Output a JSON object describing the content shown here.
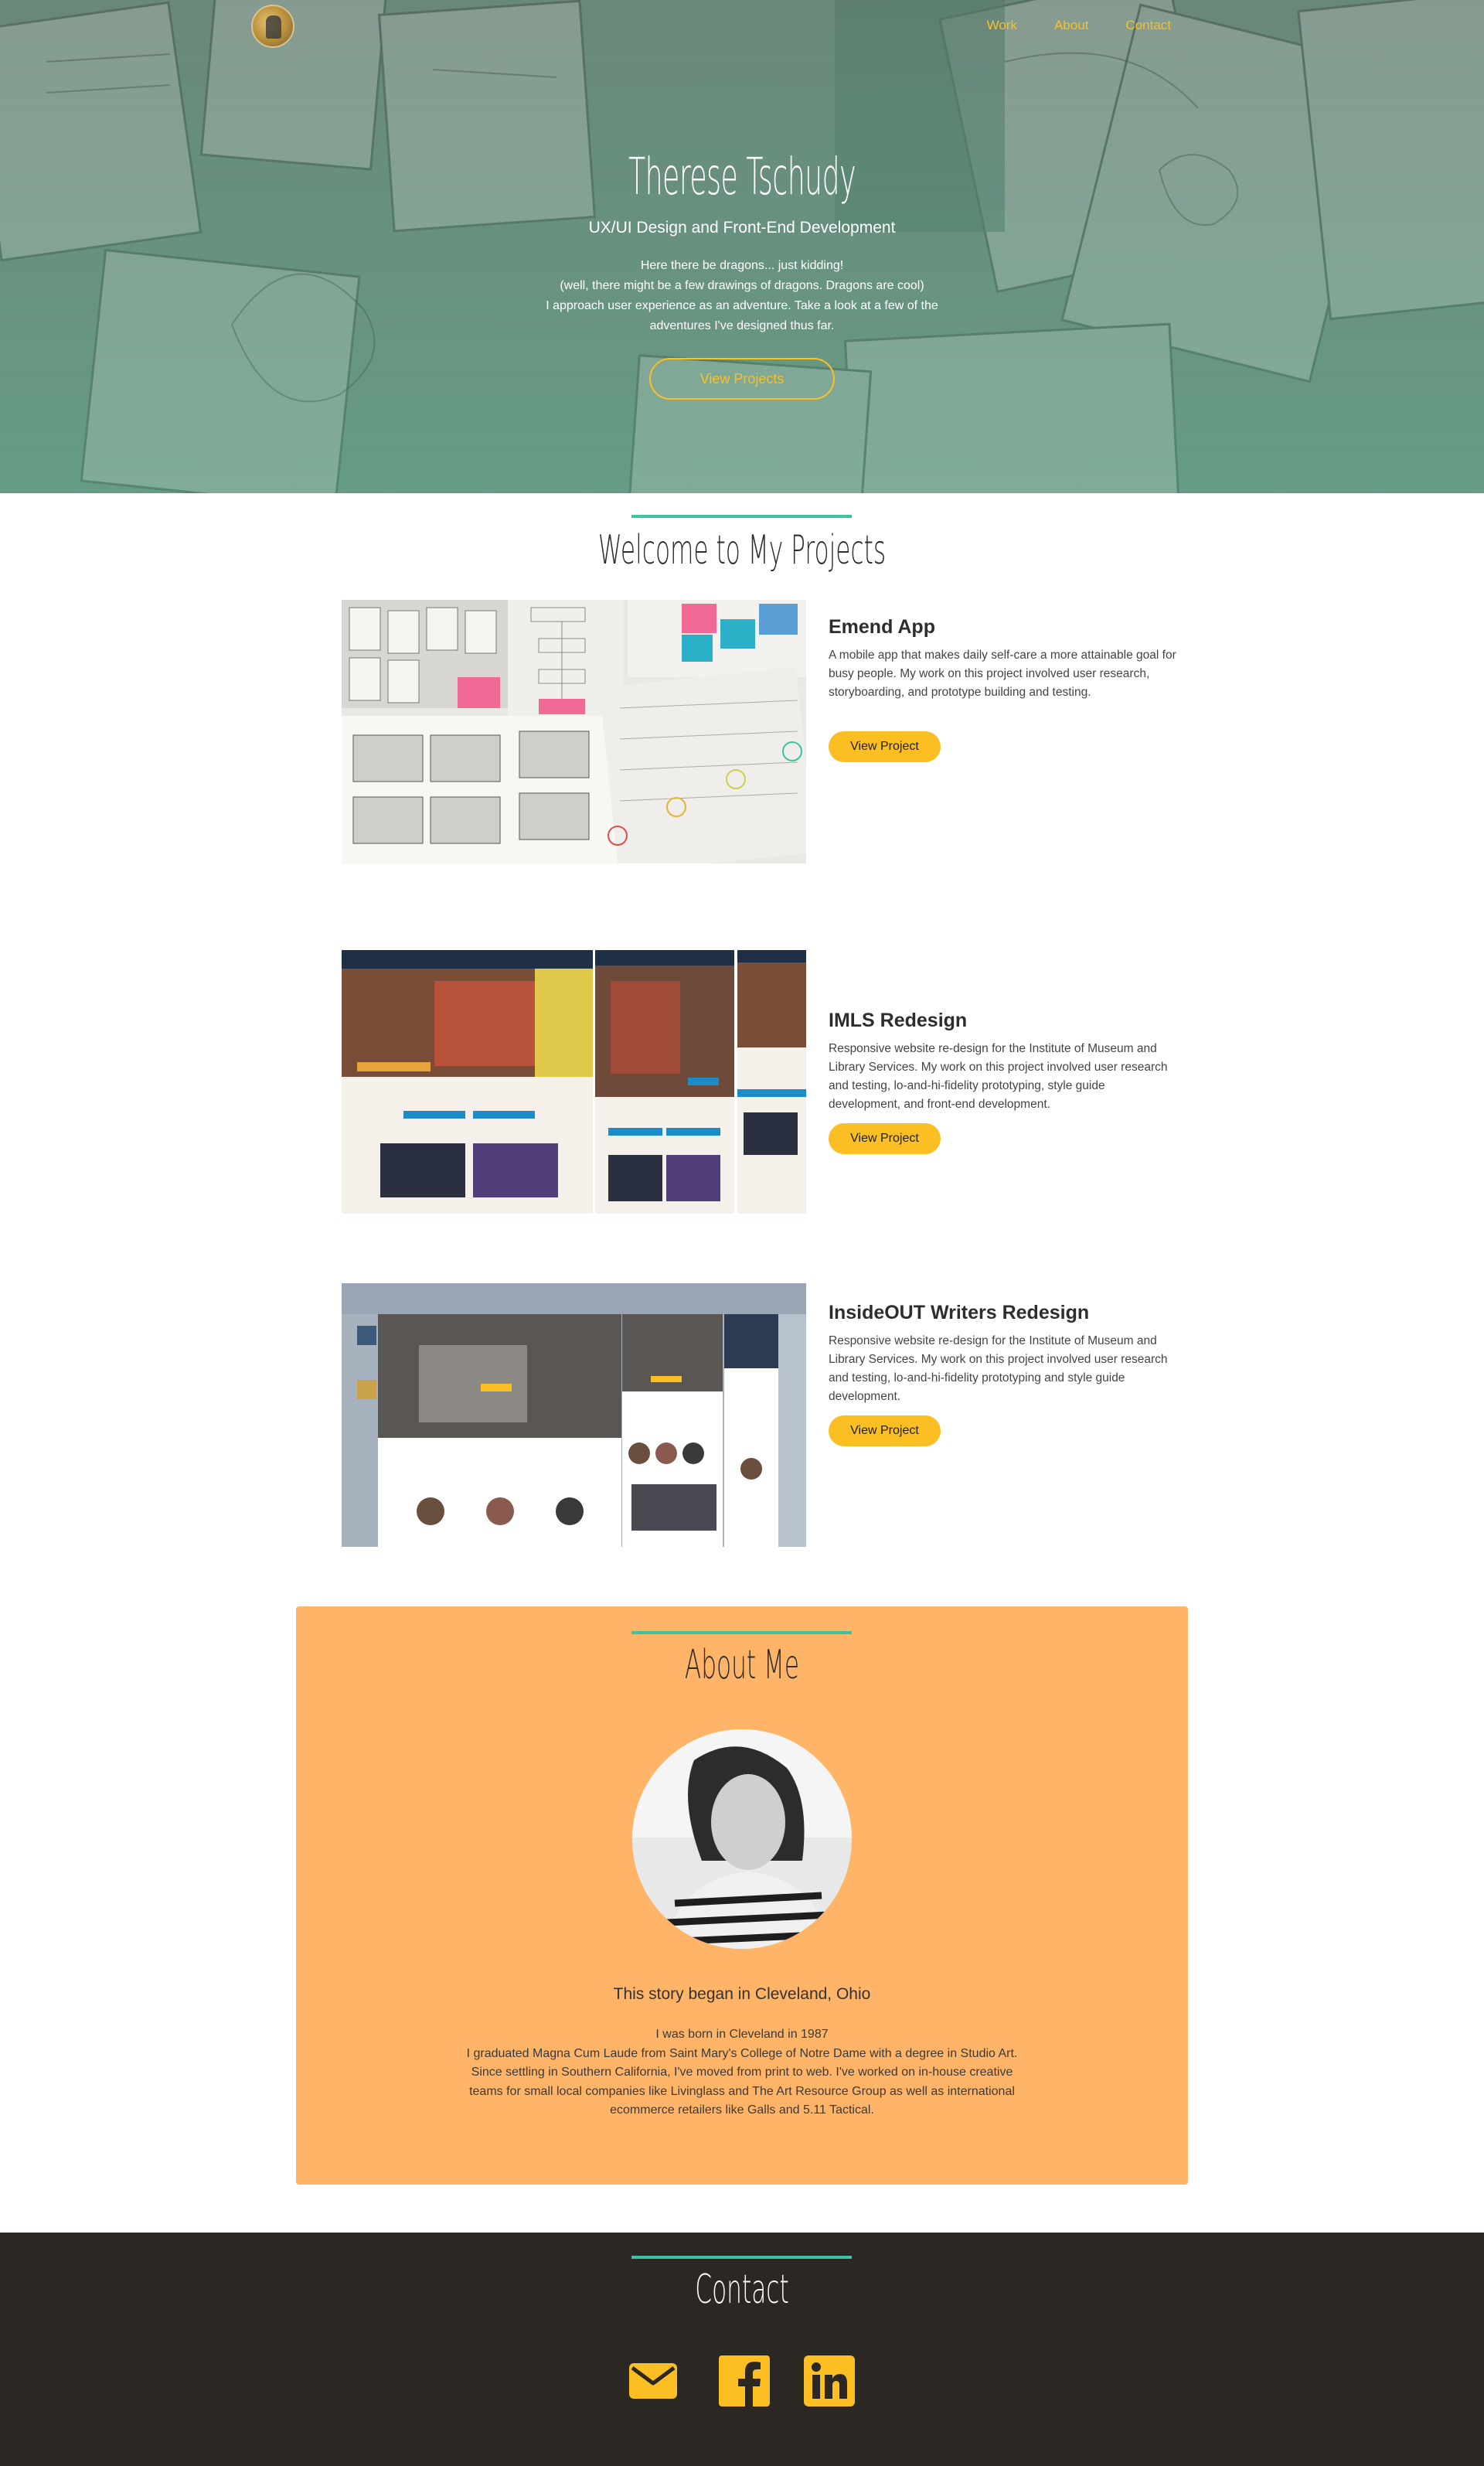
{
  "header": {
    "nav": [
      {
        "label": "Work"
      },
      {
        "label": "About"
      },
      {
        "label": "Contact"
      }
    ]
  },
  "hero": {
    "title": "Therese Tschudy",
    "subtitle": "UX/UI Design and Front-End Development",
    "lines": [
      "Here there be dragons... just kidding!",
      "(well, there might be a few drawings of dragons. Dragons are cool)",
      "I approach user experience as an adventure. Take a look at a few of the",
      "adventures I've designed thus far."
    ],
    "button_label": "View Projects"
  },
  "projects": {
    "title": "Welcome to My Projects",
    "items": [
      {
        "name": "Emend App",
        "description": "A mobile app that makes daily self-care a more attainable goal for busy people. My work on this project involved user research, storyboarding, and prototype building and testing.",
        "button_label": "View Project"
      },
      {
        "name": "IMLS Redesign",
        "description": "Responsive website re-design for the Institute of Museum and Library Services. My work on this project involved user research and testing, lo-and-hi-fidelity prototyping, style guide development, and front-end development.",
        "button_label": "View Project"
      },
      {
        "name": "InsideOUT Writers Redesign",
        "description": "Responsive website re-design for the Institute of Museum and Library Services. My work on this project involved user research and testing, lo-and-hi-fidelity prototyping and style guide development.",
        "button_label": "View Project"
      }
    ]
  },
  "about": {
    "title": "About Me",
    "heading": "This story began in Cleveland, Ohio",
    "lines": [
      "I was born in Cleveland in 1987",
      "I graduated Magna Cum Laude from Saint Mary's College of Notre Dame with a degree in Studio Art.",
      "Since settling in Southern California, I've moved from print to web. I've worked on in-house creative teams for small local companies like Livinglass and The Art Resource Group as well as international ecommerce retailers like Galls and 5.11 Tactical."
    ]
  },
  "contact": {
    "title": "Contact",
    "icons": [
      "envelope-icon",
      "facebook-icon",
      "linkedin-icon"
    ]
  },
  "colors": {
    "accent": "#fbbf24",
    "line": "#3cc39f",
    "about_bg": "#ffb468",
    "footer_bg": "#2b2722"
  }
}
